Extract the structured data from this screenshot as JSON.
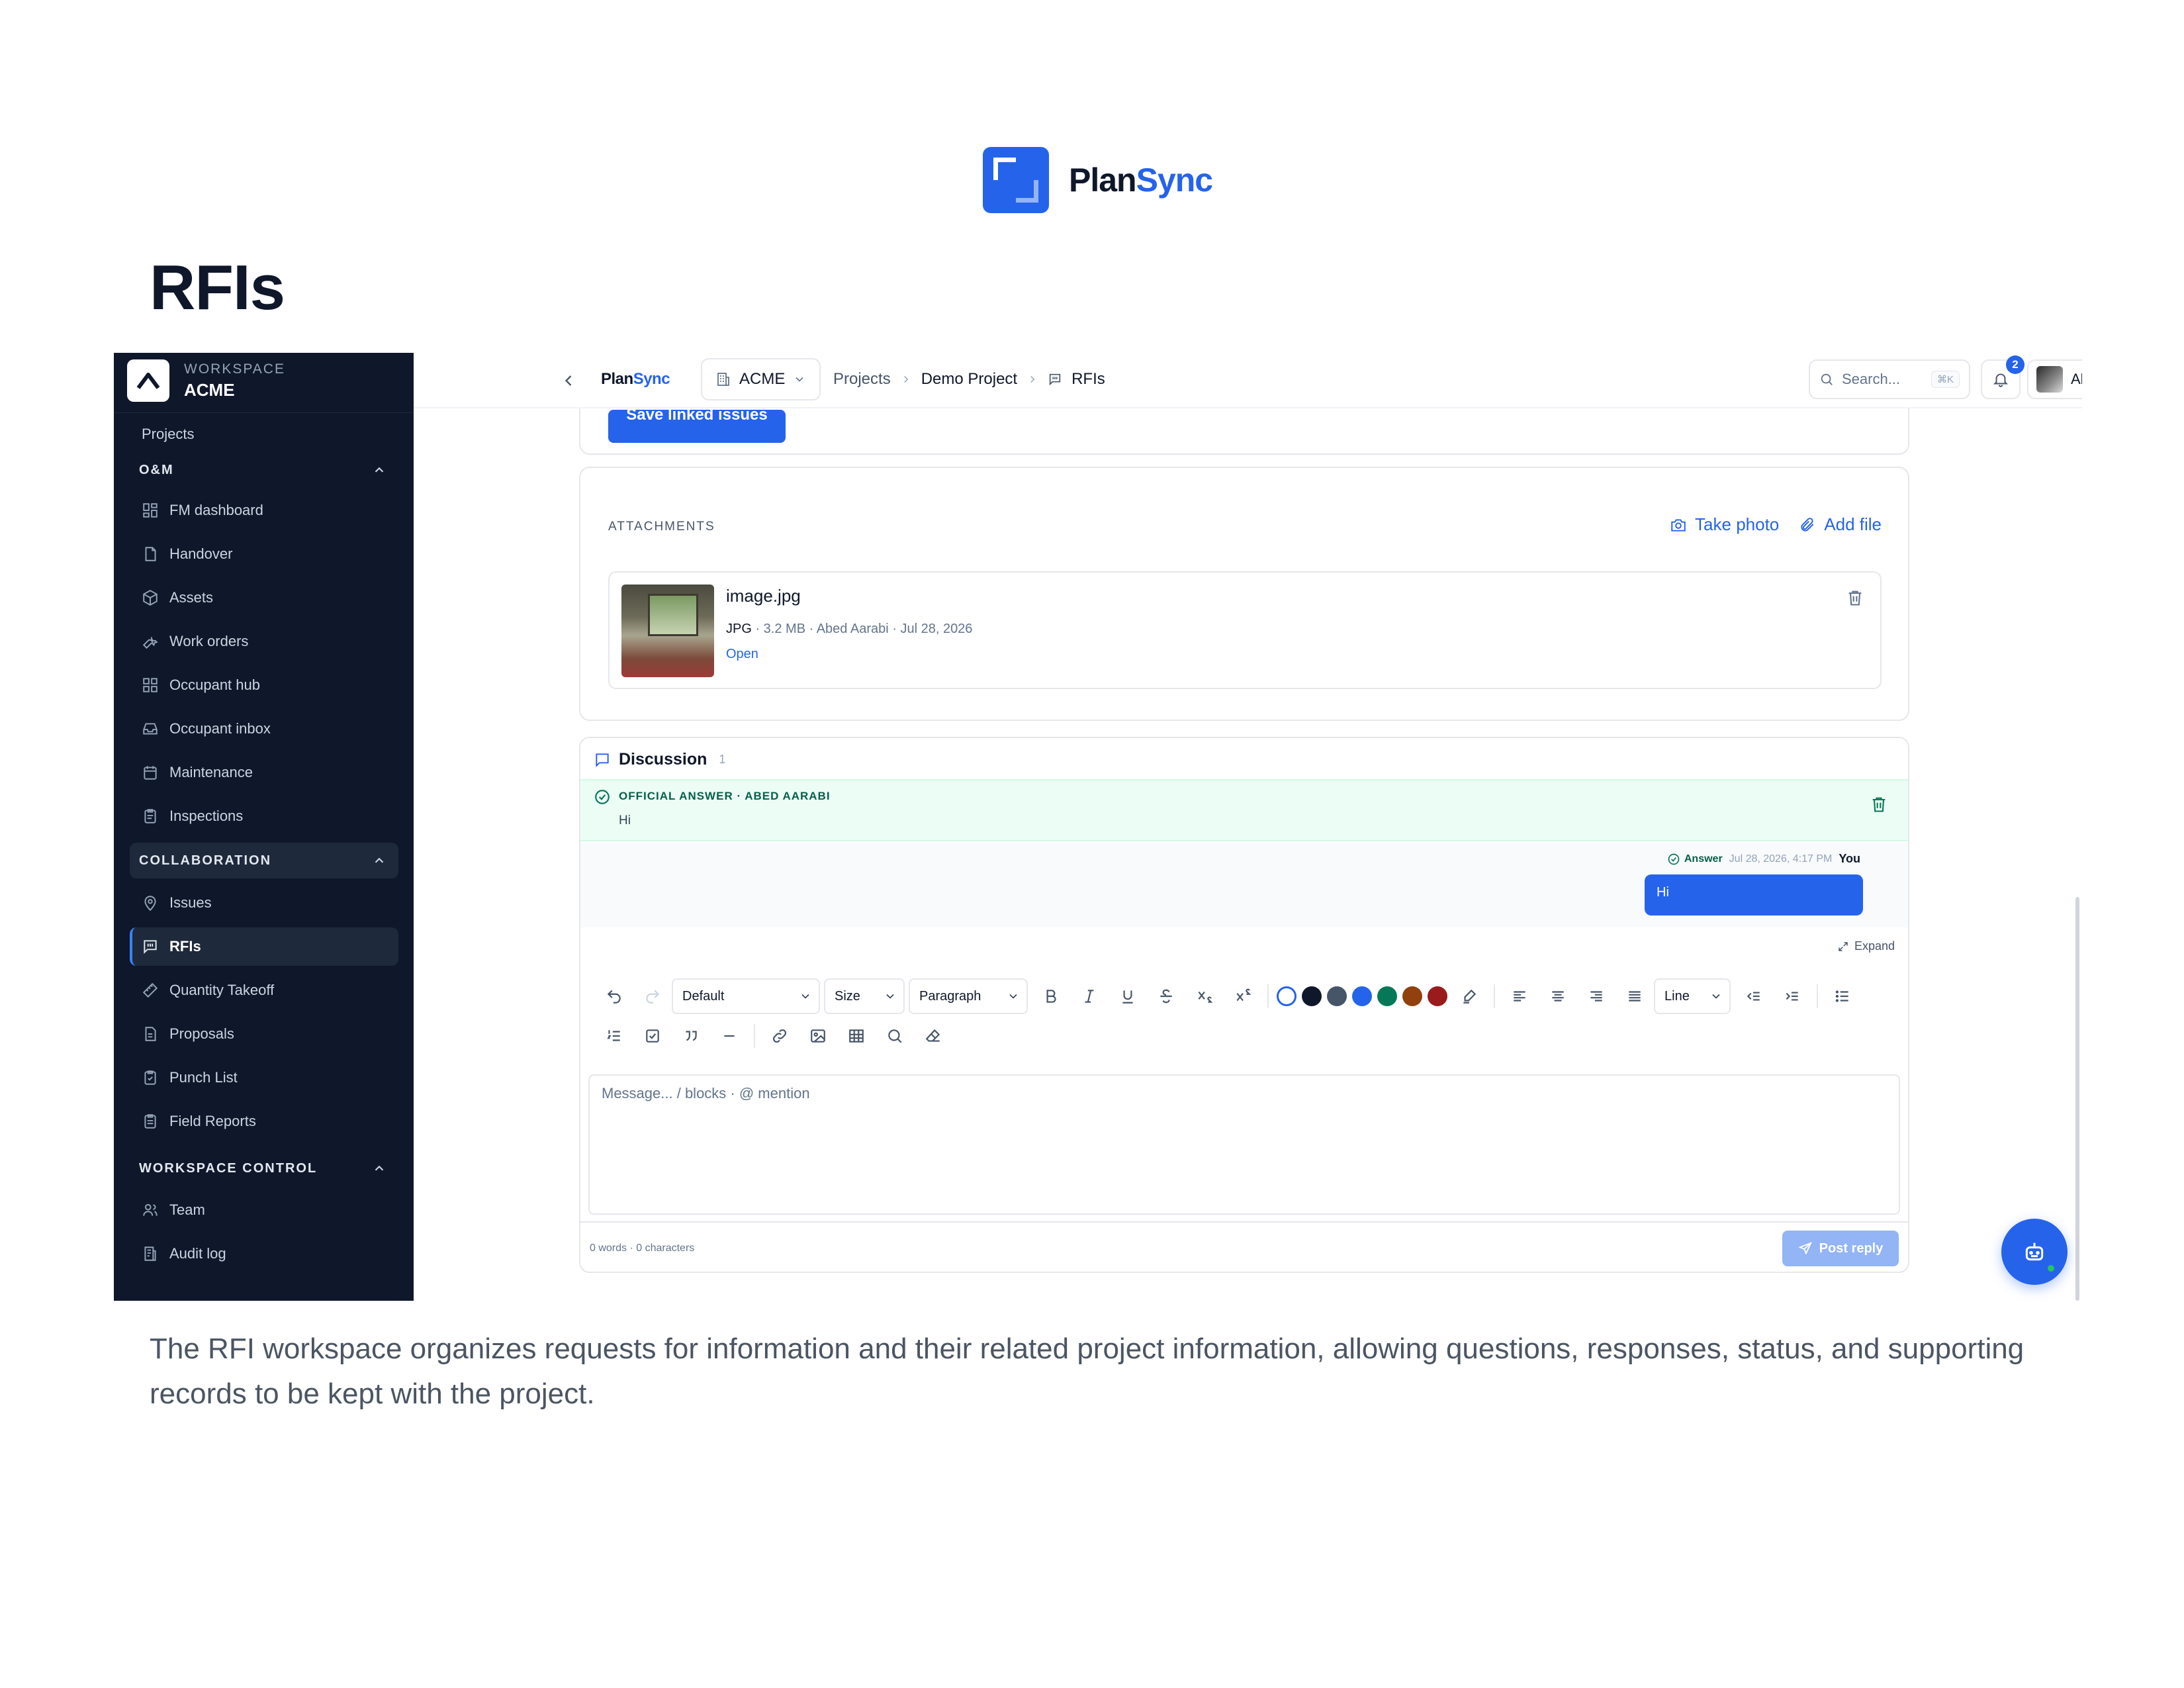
{
  "brand": {
    "name_part1": "Plan",
    "name_part2": "Sync"
  },
  "doc": {
    "title": "RFIs",
    "caption": "The RFI workspace organizes requests for information and their related project information, allowing questions, responses, status, and supporting records to be kept with the project."
  },
  "sidebar": {
    "workspace_label": "WORKSPACE",
    "workspace_name": "ACME",
    "projects_link": "Projects",
    "sections": [
      {
        "label": "O&M",
        "items": [
          "FM dashboard",
          "Handover",
          "Assets",
          "Work orders",
          "Occupant hub",
          "Occupant inbox",
          "Maintenance",
          "Inspections"
        ]
      },
      {
        "label": "COLLABORATION",
        "items": [
          "Issues",
          "RFIs",
          "Quantity Takeoff",
          "Proposals",
          "Punch List",
          "Field Reports"
        ]
      },
      {
        "label": "WORKSPACE CONTROL",
        "items": [
          "Team",
          "Audit log"
        ]
      }
    ],
    "active_item": "RFIs"
  },
  "topbar": {
    "brand_part1": "Plan",
    "brand_part2": "Sync",
    "org": "ACME",
    "breadcrumbs": [
      "Projects",
      "Demo Project",
      "RFIs"
    ],
    "search_placeholder": "Search...",
    "search_shortcut": "⌘K",
    "notification_count": "2",
    "user_name": "Abed Aarabi"
  },
  "linked_issues": {
    "save_label": "Save linked issues"
  },
  "attachments": {
    "label": "ATTACHMENTS",
    "take_photo": "Take photo",
    "add_file": "Add file",
    "file": {
      "name": "image.jpg",
      "type": "JPG",
      "meta": " · 3.2 MB · Abed Aarabi · Jul 28, 2026",
      "open": "Open"
    }
  },
  "discussion": {
    "title": "Discussion",
    "count": "1",
    "official_title": "OFFICIAL ANSWER · ABED AARABI",
    "official_text": "Hi",
    "message": {
      "tag": "Answer",
      "time": "Jul 28, 2026, 4:17 PM",
      "author": "You",
      "text": "Hi"
    },
    "expand": "Expand",
    "font_select": "Default",
    "size_select": "Size",
    "block_select": "Paragraph",
    "line_select": "Line",
    "colors": [
      "#ffffff",
      "#0f172a",
      "#475569",
      "#2563eb",
      "#047857",
      "#92400e",
      "#991b1b"
    ],
    "placeholder": "Message... / blocks · @ mention",
    "counts": "0 words · 0 characters",
    "post_label": "Post reply"
  }
}
